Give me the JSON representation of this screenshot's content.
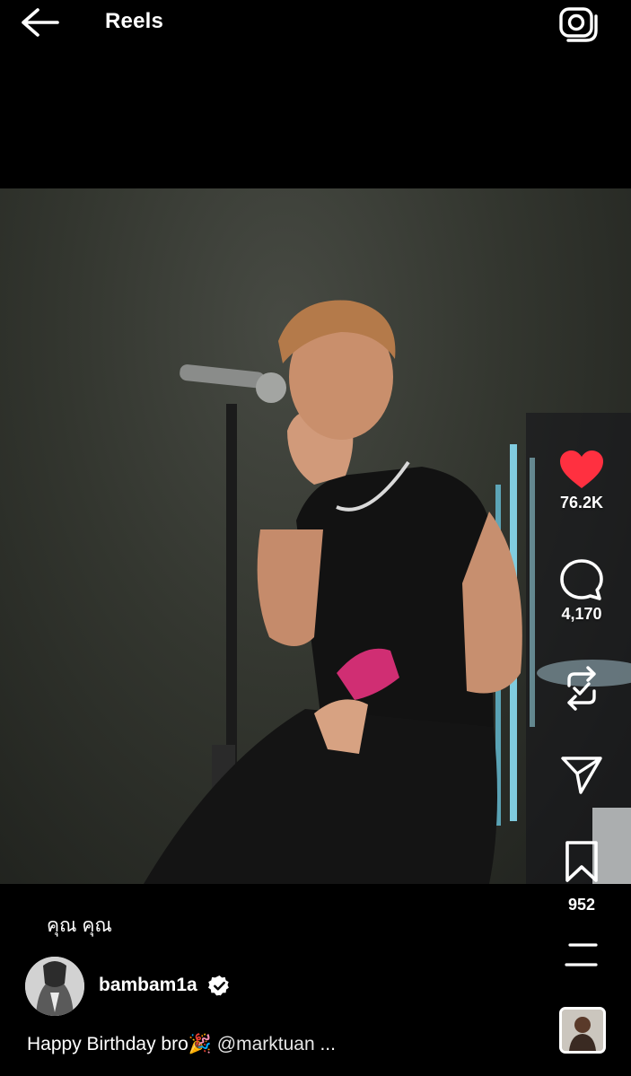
{
  "header": {
    "title": "Reels",
    "back_icon": "arrow-left-icon",
    "camera_icon": "camera-icon"
  },
  "video": {
    "description_icon": "video-frame"
  },
  "actions": {
    "like": {
      "icon": "heart-filled-icon",
      "count": "76.2K",
      "color": "#ff3040"
    },
    "comment": {
      "icon": "comment-bubble-icon",
      "count": "4,170"
    },
    "remix": {
      "icon": "remix-icon"
    },
    "share": {
      "icon": "paper-plane-icon"
    },
    "save": {
      "icon": "bookmark-icon",
      "count": "952"
    },
    "more": {
      "icon": "more-lines-icon"
    }
  },
  "audio": {
    "label": "คุณ คุณ"
  },
  "author": {
    "username": "bambam1a",
    "verified_icon": "verified-badge-icon"
  },
  "caption": {
    "text": "Happy Birthday bro🎉",
    "mention": "@marktuan",
    "ellipsis": "..."
  }
}
